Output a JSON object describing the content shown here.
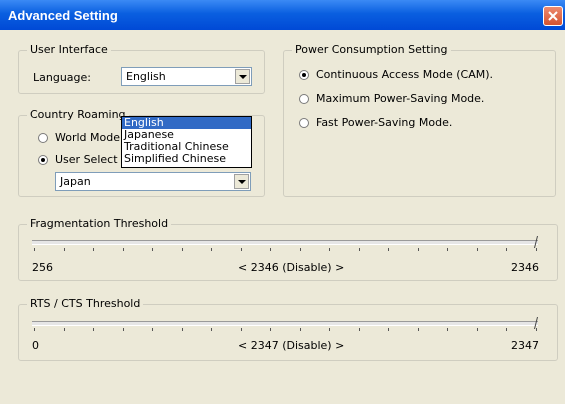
{
  "window": {
    "title": "Advanced Setting"
  },
  "user_interface": {
    "legend": "User Interface",
    "language_label": "Language:",
    "language_value": "English",
    "language_options": [
      "English",
      "Japanese",
      "Traditional Chinese",
      "Simplified Chinese"
    ]
  },
  "country_roaming": {
    "legend": "Country Roaming",
    "world_mode": "World Mode",
    "user_select": "User Select",
    "selected_mode": "User Select",
    "country_value": "Japan"
  },
  "power": {
    "legend": "Power Consumption Setting",
    "options": [
      "Continuous Access Mode (CAM).",
      "Maximum Power-Saving Mode.",
      "Fast Power-Saving Mode."
    ],
    "selected": "Continuous Access Mode (CAM)."
  },
  "fragmentation": {
    "legend": "Fragmentation Threshold",
    "min": "256",
    "current": "< 2346 (Disable) >",
    "max": "2346",
    "level": 1.0
  },
  "rts": {
    "legend": "RTS / CTS Threshold",
    "min": "0",
    "current": "< 2347 (Disable) >",
    "max": "2347",
    "level": 1.0
  },
  "icons": {
    "close": "close-icon",
    "dropdown": "chevron-down-icon",
    "slider": "slider-thumb"
  }
}
